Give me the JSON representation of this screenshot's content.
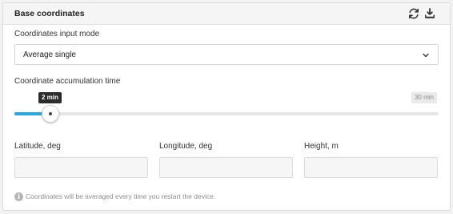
{
  "panel": {
    "title": "Base coordinates",
    "icons": {
      "refresh": "refresh-icon",
      "download": "download-icon"
    }
  },
  "input_mode": {
    "label": "Coordinates input mode",
    "value": "Average single"
  },
  "accumulation": {
    "label": "Coordinate accumulation time",
    "value_label": "2 min",
    "max_label": "30 min",
    "value_fraction": 0.05,
    "fill_color": "#29a8e0"
  },
  "fields": [
    {
      "label": "Latitude, deg",
      "value": ""
    },
    {
      "label": "Longitude, deg",
      "value": ""
    },
    {
      "label": "Height, m",
      "value": ""
    }
  ],
  "hint": {
    "icon": "info-icon",
    "text": "Coordinates will be averaged every time you restart the device."
  }
}
